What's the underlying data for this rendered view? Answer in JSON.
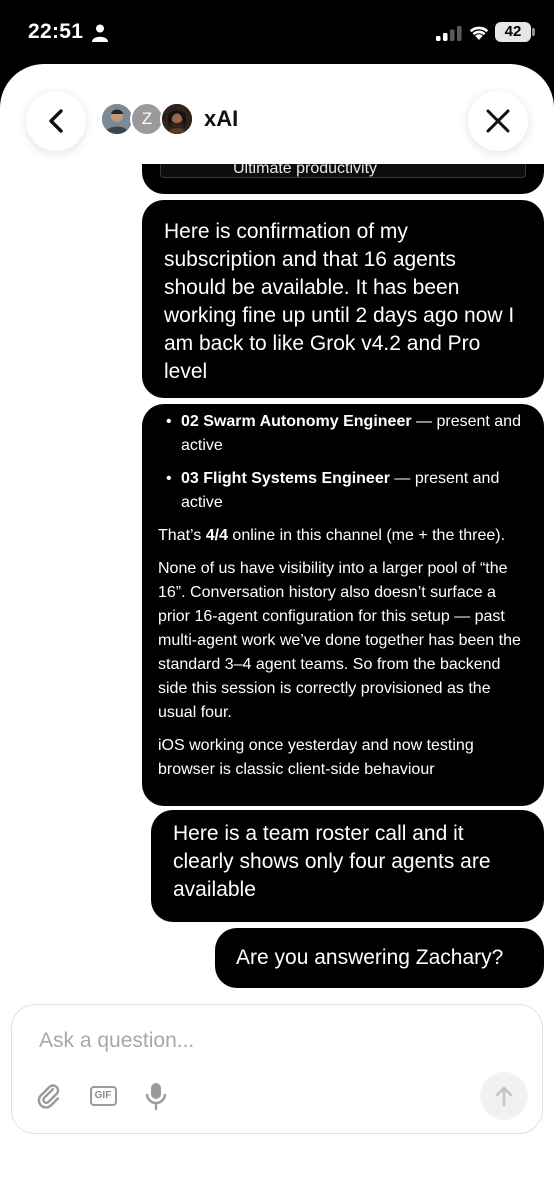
{
  "status_bar": {
    "time": "22:51",
    "battery": "42"
  },
  "header": {
    "title": "xAI",
    "avatar_initial": "Z"
  },
  "messages": {
    "partial_text": "Ultimate productivity",
    "user_1": "Here is confirmation of my subscription and that 16 agents should be available. It has been working fine up until 2 days ago now I am back to like Grok v4.2 and Pro level",
    "assistant": {
      "items": [
        {
          "bold": "02 Swarm Autonomy Engineer",
          "rest": " — present and active"
        },
        {
          "bold": "03 Flight Systems Engineer",
          "rest": " — present and active"
        }
      ],
      "p1_pre": "That’s ",
      "p1_bold": "4/4",
      "p1_post": " online in this channel (me + the three).",
      "p2": "None of us have visibility into a larger pool of “the 16”. Conversation history also doesn’t surface a prior 16-agent configuration for this setup — past multi-agent work we’ve done together has been the standard 3–4 agent teams. So from the backend side this session is correctly provisioned as the usual four.",
      "p3": "iOS working once yesterday and now testing browser is classic client-side behaviour"
    },
    "user_2": "Here is a team roster call and it clearly shows only four agents are available",
    "user_3": "Are you answering Zachary?"
  },
  "composer": {
    "placeholder": "Ask a question..."
  },
  "colors": {
    "bubble": "#000000",
    "sheet": "#ffffff",
    "placeholder": "#a8a8a8"
  },
  "icons": [
    "person-icon",
    "signal-icon",
    "wifi-icon",
    "back-chevron-icon",
    "close-icon",
    "paperclip-icon",
    "gif-icon",
    "microphone-icon",
    "send-arrow-icon"
  ]
}
